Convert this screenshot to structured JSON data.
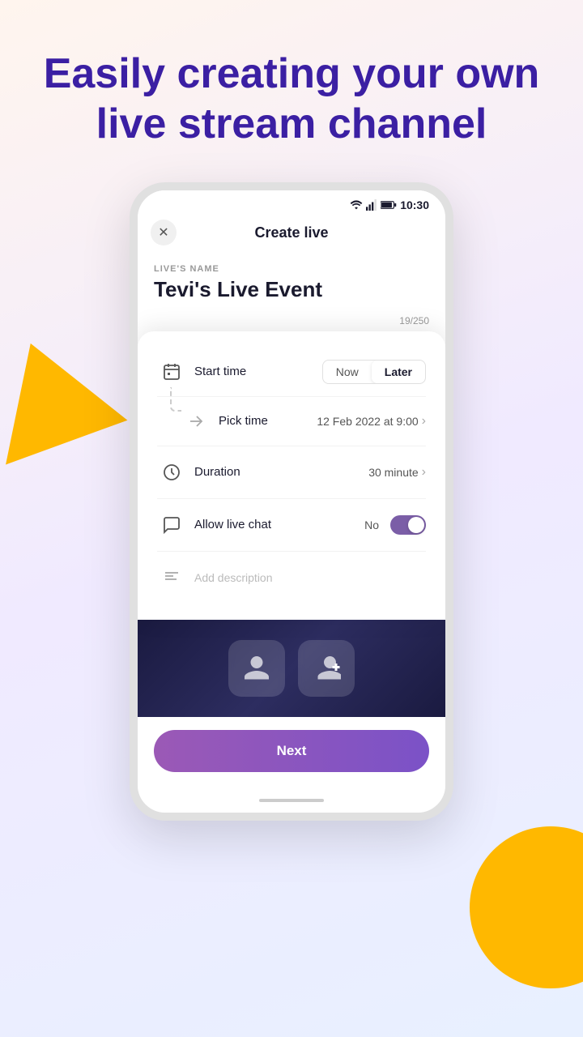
{
  "hero": {
    "title": "Easily creating your own live stream channel"
  },
  "status_bar": {
    "time": "10:30"
  },
  "header": {
    "title": "Create live",
    "close_label": "×"
  },
  "form": {
    "field_label": "LIVE'S NAME",
    "field_value": "Tevi's Live Event",
    "char_count": "19/250"
  },
  "start_time": {
    "label": "Start time",
    "options": [
      "Now",
      "Later"
    ],
    "selected": "Later"
  },
  "pick_time": {
    "label": "Pick time",
    "value": "12 Feb 2022 at 9:00"
  },
  "duration": {
    "label": "Duration",
    "value": "30 minute"
  },
  "live_chat": {
    "label": "Allow live chat",
    "value": "No",
    "enabled": true
  },
  "description": {
    "placeholder": "Add description"
  },
  "next_button": {
    "label": "Next"
  }
}
